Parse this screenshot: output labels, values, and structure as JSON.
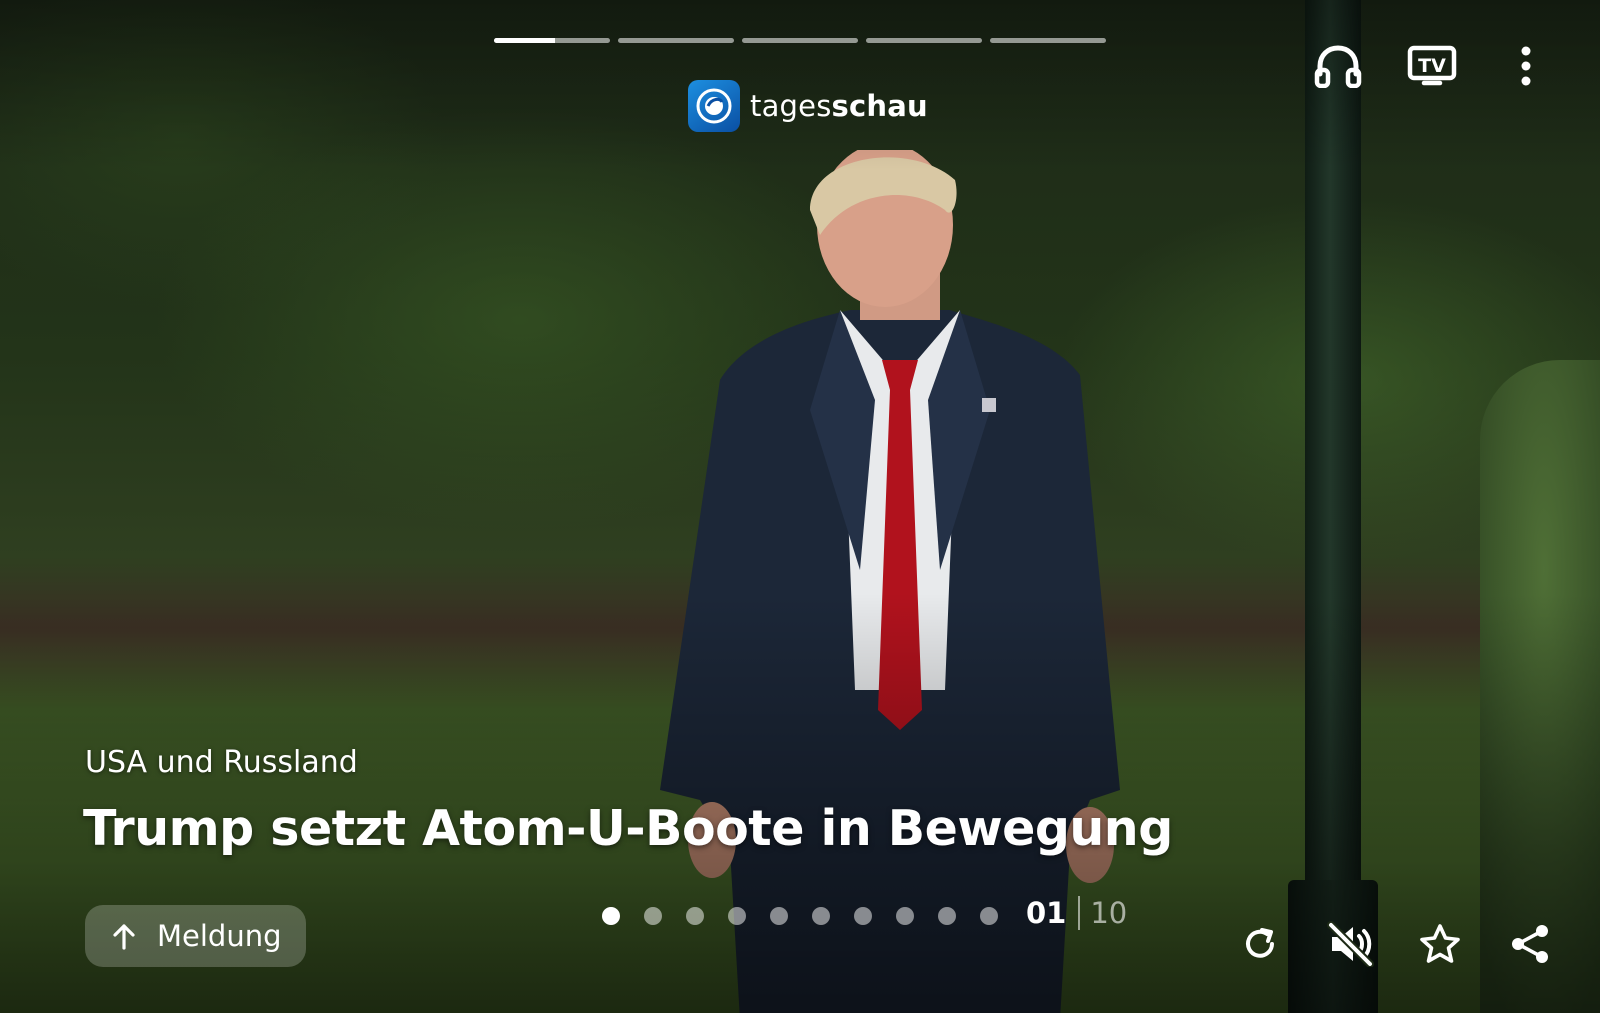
{
  "brand": {
    "name_light": "tages",
    "name_bold": "schau"
  },
  "story_progress": {
    "segments": 5,
    "current_segment_fill": 0.53
  },
  "top_icons": [
    "headphones-icon",
    "tv-icon",
    "more-vertical-icon"
  ],
  "article": {
    "kicker": "USA und Russland",
    "headline": "Trump setzt Atom-U-Boote in Bewegung"
  },
  "meldung_button": {
    "label": "Meldung",
    "icon": "arrow-up-icon"
  },
  "pager": {
    "total_dots": 10,
    "active_index": 0,
    "current": "01",
    "total": "10"
  },
  "bottom_icons": [
    "replay-icon",
    "muted-speaker-icon",
    "star-icon",
    "share-icon"
  ],
  "colors": {
    "accent_logo": "#0a4fa3",
    "tie_red": "#b1121d",
    "suit_navy": "#1c2738"
  }
}
